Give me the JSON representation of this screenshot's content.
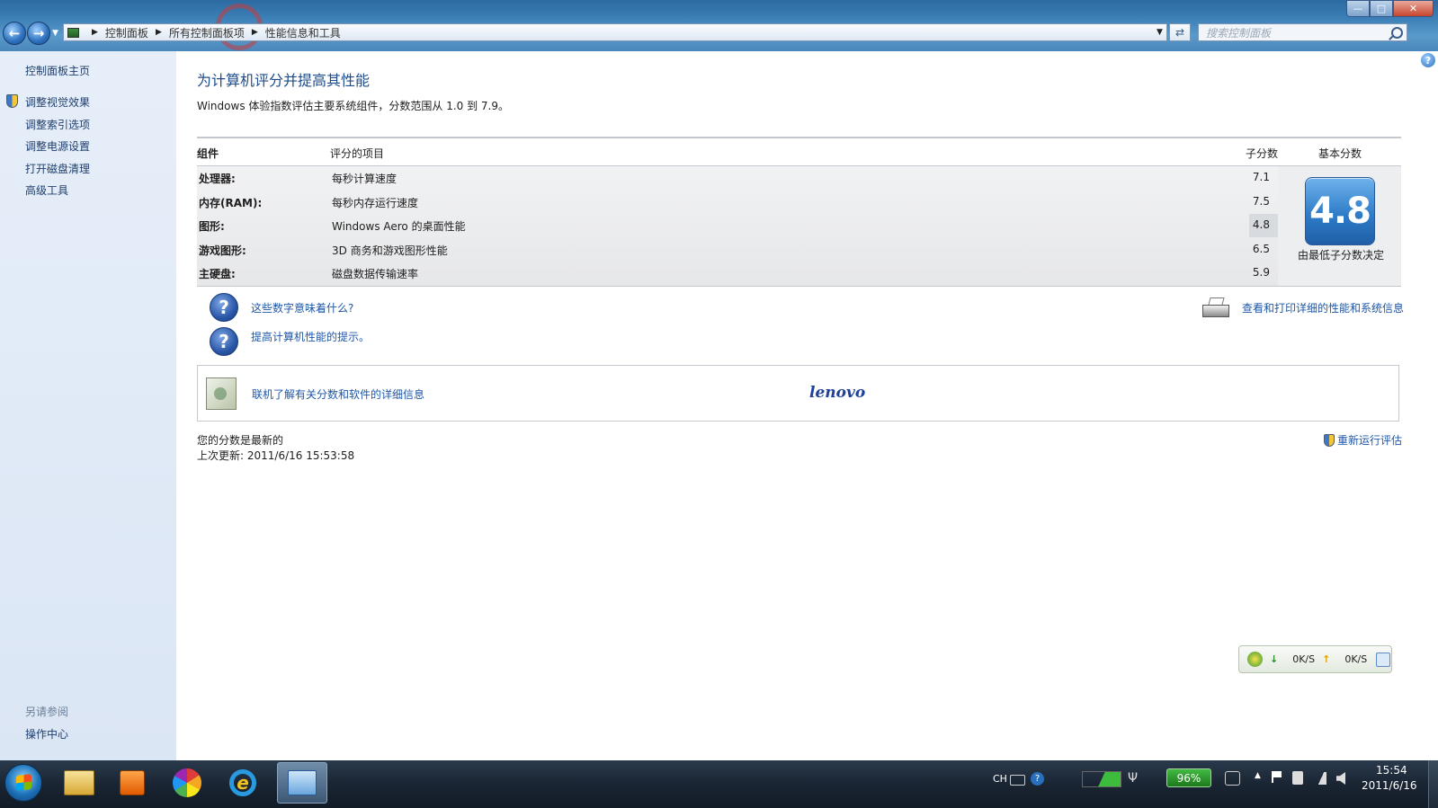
{
  "window": {
    "minimize_glyph": "—",
    "maximize_glyph": "□",
    "close_glyph": "✕"
  },
  "address": {
    "crumbs": [
      "控制面板",
      "所有控制面板项",
      "性能信息和工具"
    ],
    "search_placeholder": "搜索控制面板"
  },
  "sidebar": {
    "home": "控制面板主页",
    "items": [
      "调整视觉效果",
      "调整索引选项",
      "调整电源设置",
      "打开磁盘清理",
      "高级工具"
    ],
    "see_also_label": "另请参阅",
    "see_also_items": [
      "操作中心"
    ]
  },
  "main": {
    "title": "为计算机评分并提高其性能",
    "description": "Windows 体验指数评估主要系统组件，分数范围从 1.0 到 7.9。",
    "headers": {
      "component": "组件",
      "item": "评分的项目",
      "subscore": "子分数",
      "basescore": "基本分数"
    },
    "rows": [
      {
        "component": "处理器:",
        "item": "每秒计算速度",
        "subscore": "7.1"
      },
      {
        "component": "内存(RAM):",
        "item": "每秒内存运行速度",
        "subscore": "7.5"
      },
      {
        "component": "图形:",
        "item": "Windows Aero 的桌面性能",
        "subscore": "4.8"
      },
      {
        "component": "游戏图形:",
        "item": "3D 商务和游戏图形性能",
        "subscore": "6.5"
      },
      {
        "component": "主硬盘:",
        "item": "磁盘数据传输速率",
        "subscore": "5.9"
      }
    ],
    "base_score": "4.8",
    "base_caption": "由最低子分数决定",
    "help_links": [
      "这些数字意味着什么?",
      "提高计算机性能的提示。"
    ],
    "print_link": "查看和打印详细的性能和系统信息",
    "online_link": "联机了解有关分数和软件的详细信息",
    "brand_logo": "lenovo",
    "status": "您的分数是最新的",
    "last_update": "上次更新: 2011/6/16 15:53:58",
    "rerun": "重新运行评估"
  },
  "netwidget": {
    "down_arrow": "↓",
    "down": "0K/S",
    "up_arrow": "↑",
    "up": "0K/S"
  },
  "taskbar": {
    "ime": "CH",
    "battery": "96%",
    "time": "15:54",
    "date": "2011/6/16"
  },
  "colors": {
    "link": "#1f57a8",
    "title": "#1e4b8a",
    "sidebar_bg": "#dbe6f5",
    "badge": "#2f7cc8",
    "battery": "#42b942"
  }
}
